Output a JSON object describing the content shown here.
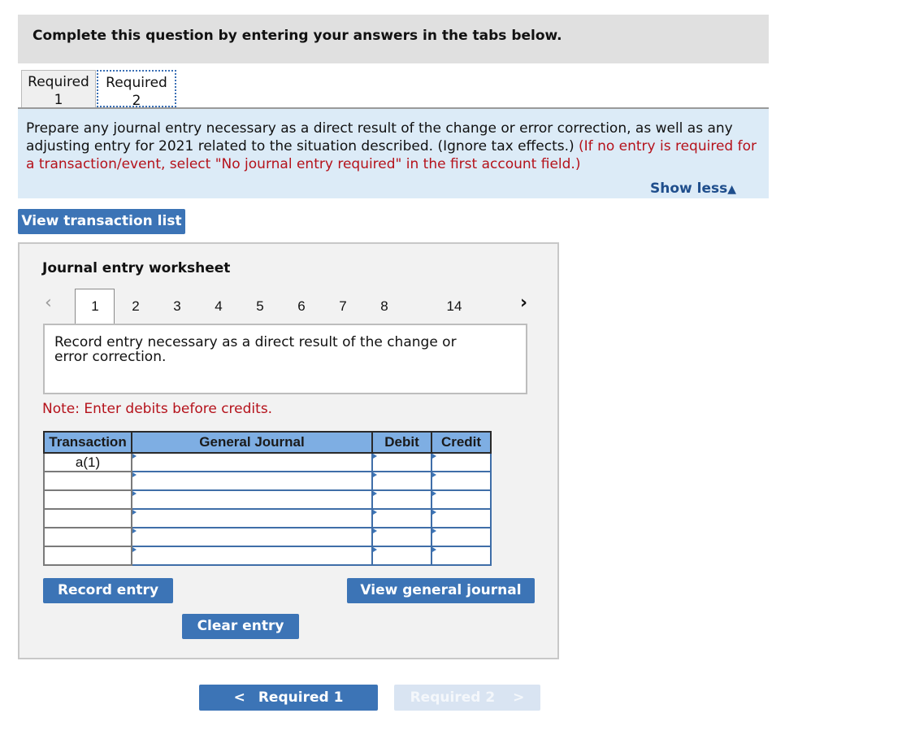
{
  "header": {
    "title": "Complete this question by entering your answers in the tabs below."
  },
  "tabs": [
    {
      "line1": "Required",
      "line2": "1",
      "active": false
    },
    {
      "line1": "Required",
      "line2": "2",
      "active": true
    }
  ],
  "instructions": {
    "text": "Prepare any journal entry necessary as a direct result of the change or error correction, as well as any adjusting entry for 2021 related to the situation described. (Ignore tax effects.) ",
    "red_text": "(If no entry is required for a transaction/event, select \"No journal entry required\" in the first account field.)",
    "show_less_label": "Show less",
    "show_less_icon": "▲"
  },
  "buttons": {
    "view_transaction_list": "View transaction list",
    "record_entry": "Record entry",
    "view_general_journal": "View general journal",
    "clear_entry": "Clear entry",
    "prev_required": "Required 1",
    "next_required": "Required 2"
  },
  "worksheet": {
    "title": "Journal entry worksheet",
    "prev_icon": "‹",
    "next_icon": "›",
    "pages": [
      "1",
      "2",
      "3",
      "4",
      "5",
      "6",
      "7",
      "8",
      "14"
    ],
    "active_page": "1",
    "entry_description": "Record entry necessary as a direct result of the change or error correction.",
    "note": "Note: Enter debits before credits.",
    "table": {
      "headers": [
        "Transaction",
        "General Journal",
        "Debit",
        "Credit"
      ],
      "rows": [
        {
          "transaction": "a(1)",
          "account": "",
          "debit": "",
          "credit": ""
        },
        {
          "transaction": "",
          "account": "",
          "debit": "",
          "credit": ""
        },
        {
          "transaction": "",
          "account": "",
          "debit": "",
          "credit": ""
        },
        {
          "transaction": "",
          "account": "",
          "debit": "",
          "credit": ""
        },
        {
          "transaction": "",
          "account": "",
          "debit": "",
          "credit": ""
        },
        {
          "transaction": "",
          "account": "",
          "debit": "",
          "credit": ""
        }
      ]
    }
  },
  "colors": {
    "primary": "#3c74b6",
    "instruction_bg": "#dcebf7",
    "alert_red": "#b5121b",
    "table_header": "#7eaee3"
  }
}
